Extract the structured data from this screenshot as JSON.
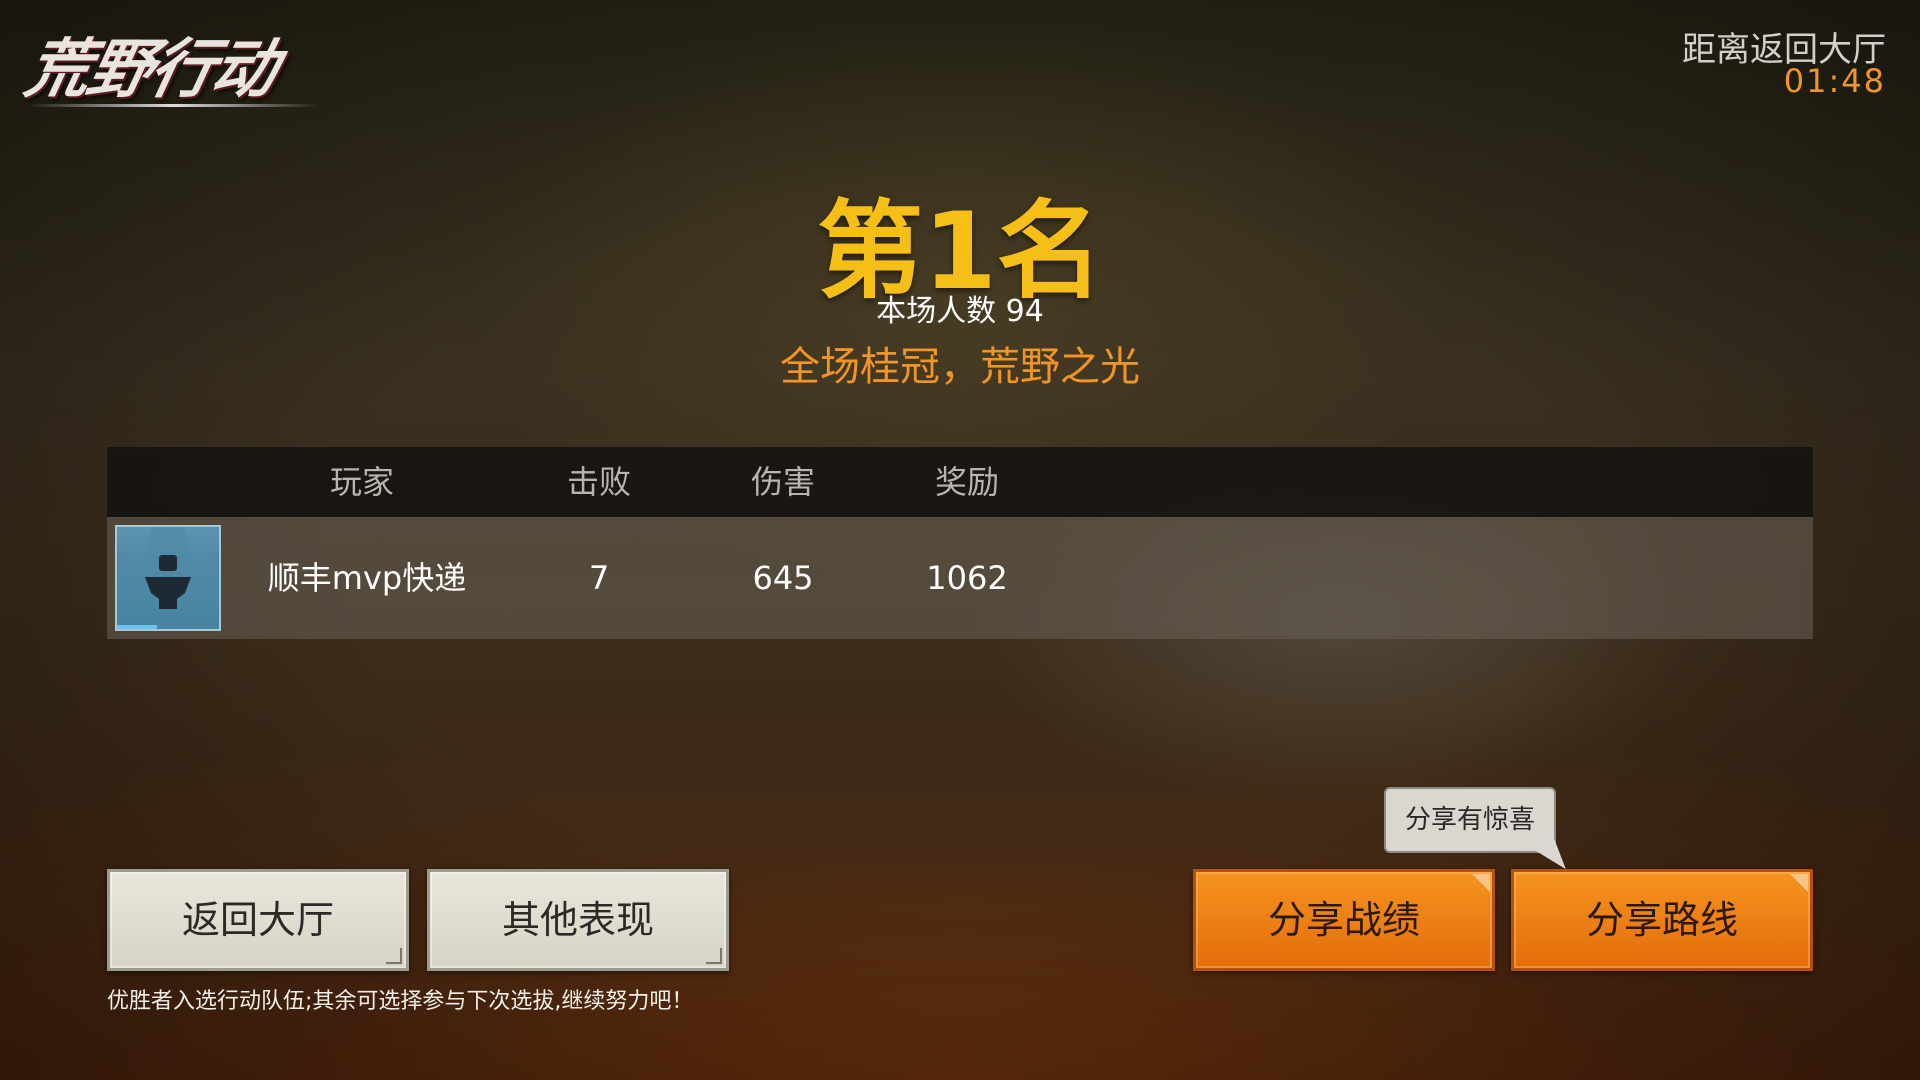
{
  "logo": {
    "text": "荒野行动"
  },
  "countdown": {
    "label": "距离返回大厅",
    "time": "01:48"
  },
  "result": {
    "rank": "第1名",
    "players_count": "本场人数 94",
    "slogan": "全场桂冠，荒野之光"
  },
  "table": {
    "headers": [
      "玩家",
      "击败",
      "伤害",
      "奖励"
    ],
    "rows": [
      {
        "avatar_icon": "soldier-avatar-icon",
        "player": "顺丰mvp快递",
        "kills": "7",
        "damage": "645",
        "reward": "1062"
      }
    ]
  },
  "buttons": {
    "return_lobby": "返回大厅",
    "other_performance": "其他表现",
    "share_record": "分享战绩",
    "share_route": "分享路线"
  },
  "tooltip": {
    "text": "分享有惊喜"
  },
  "hint": "优胜者入选行动队伍;其余可选择参与下次选拔,继续努力吧！",
  "colors": {
    "rank_gold": "#f6bf18",
    "accent_orange": "#f09526",
    "button_orange": "#e46d0b"
  }
}
